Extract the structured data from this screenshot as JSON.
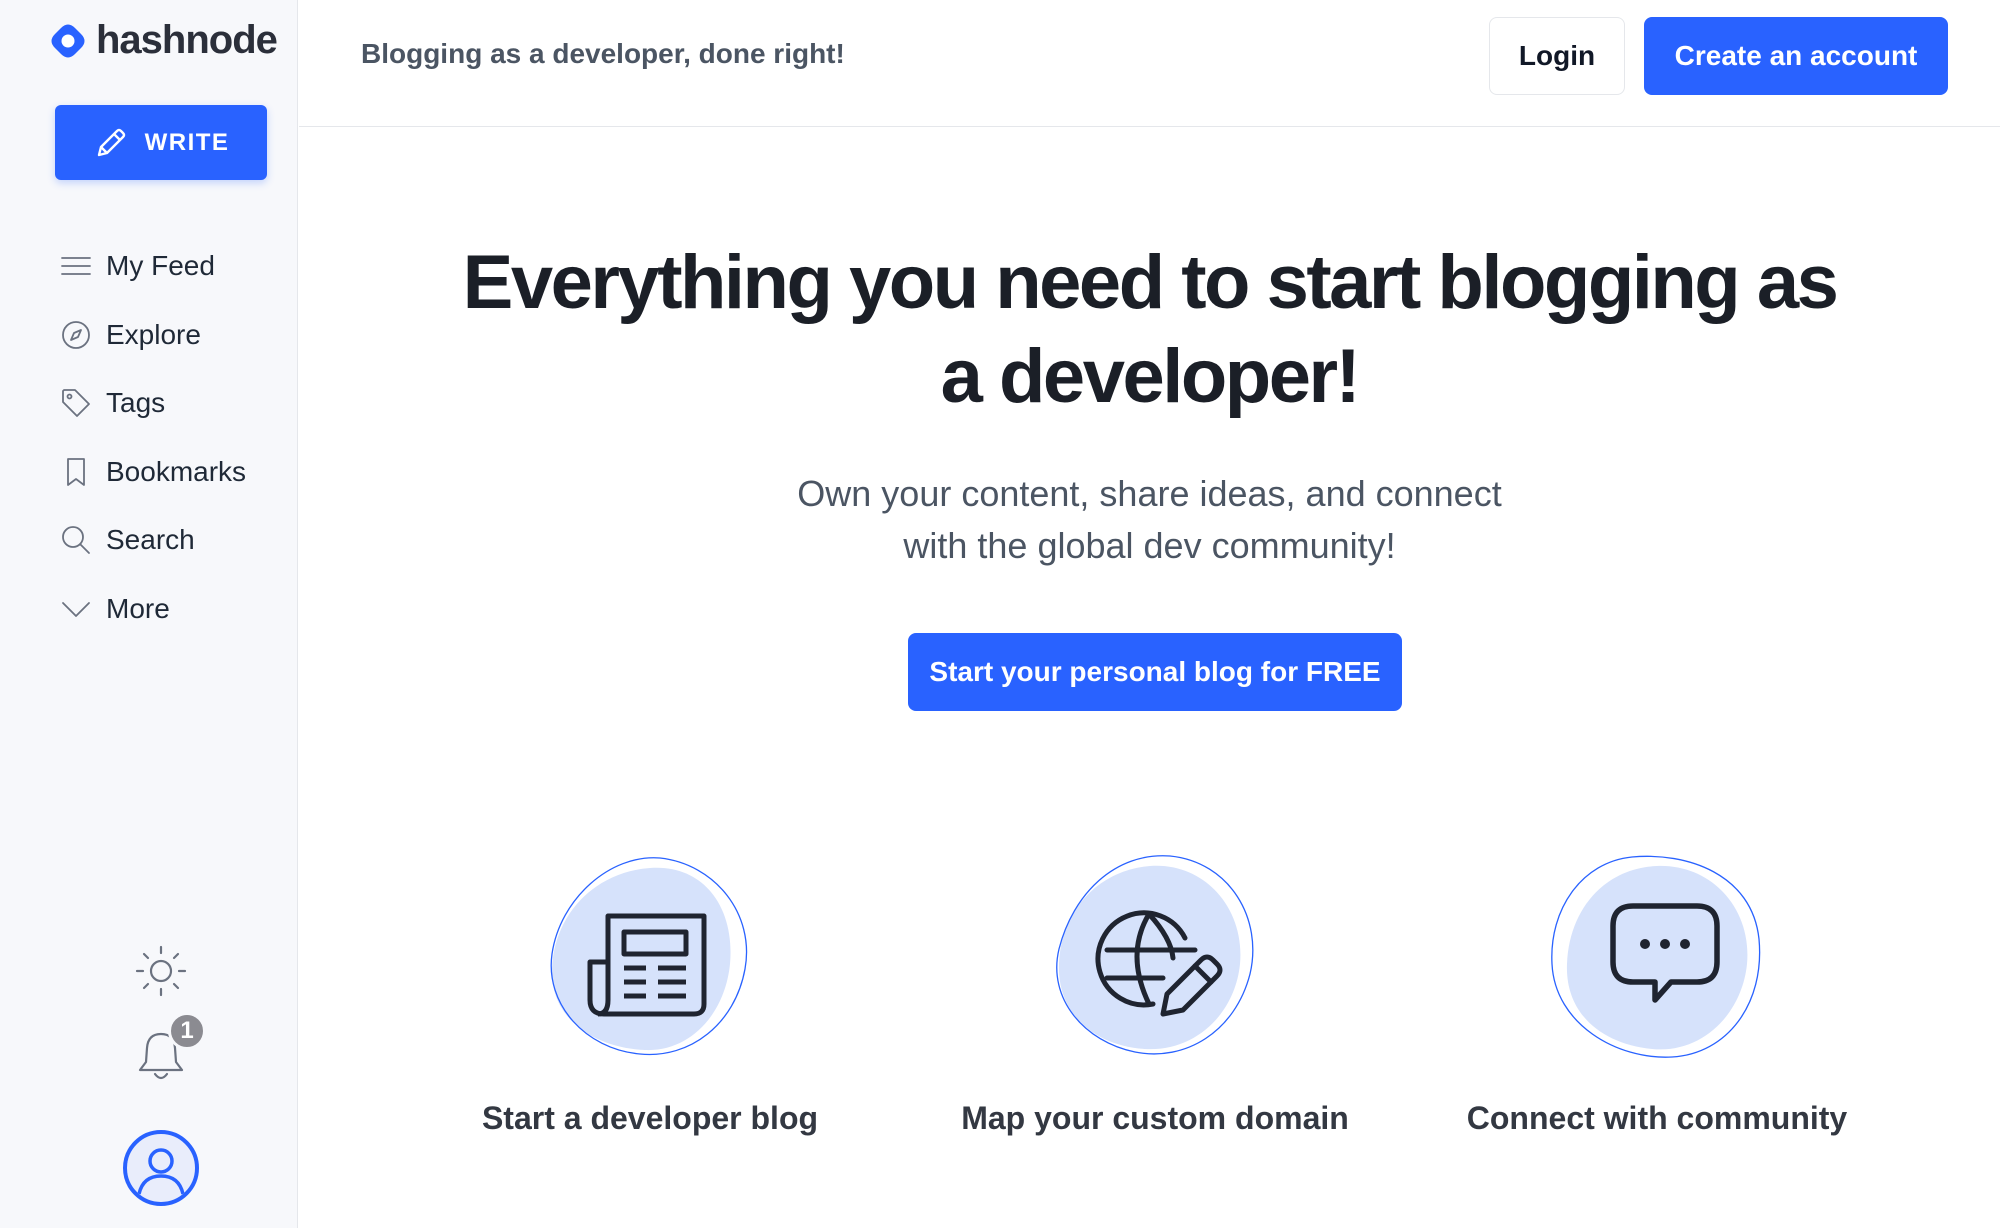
{
  "brand": {
    "name": "hashnode",
    "accent": "#2962ff"
  },
  "sidebar": {
    "write_label": "WRITE",
    "items": [
      {
        "label": "My Feed",
        "icon": "menu-lines-icon"
      },
      {
        "label": "Explore",
        "icon": "compass-icon"
      },
      {
        "label": "Tags",
        "icon": "tag-icon"
      },
      {
        "label": "Bookmarks",
        "icon": "bookmark-icon"
      },
      {
        "label": "Search",
        "icon": "search-icon"
      },
      {
        "label": "More",
        "icon": "chevron-down-icon"
      }
    ],
    "notifications_count": "1"
  },
  "header": {
    "tagline": "Blogging as a developer, done right!",
    "login_label": "Login",
    "create_account_label": "Create an account"
  },
  "hero": {
    "title": "Everything you need to start blogging as a developer!",
    "subtitle": "Own your content, share ideas, and connect with the global dev community!",
    "cta_label": "Start your personal blog for FREE"
  },
  "features": [
    {
      "label": "Start a developer blog",
      "icon": "newspaper-icon"
    },
    {
      "label": "Map your custom domain",
      "icon": "globe-pen-icon"
    },
    {
      "label": "Connect with community",
      "icon": "chat-bubble-icon"
    }
  ]
}
